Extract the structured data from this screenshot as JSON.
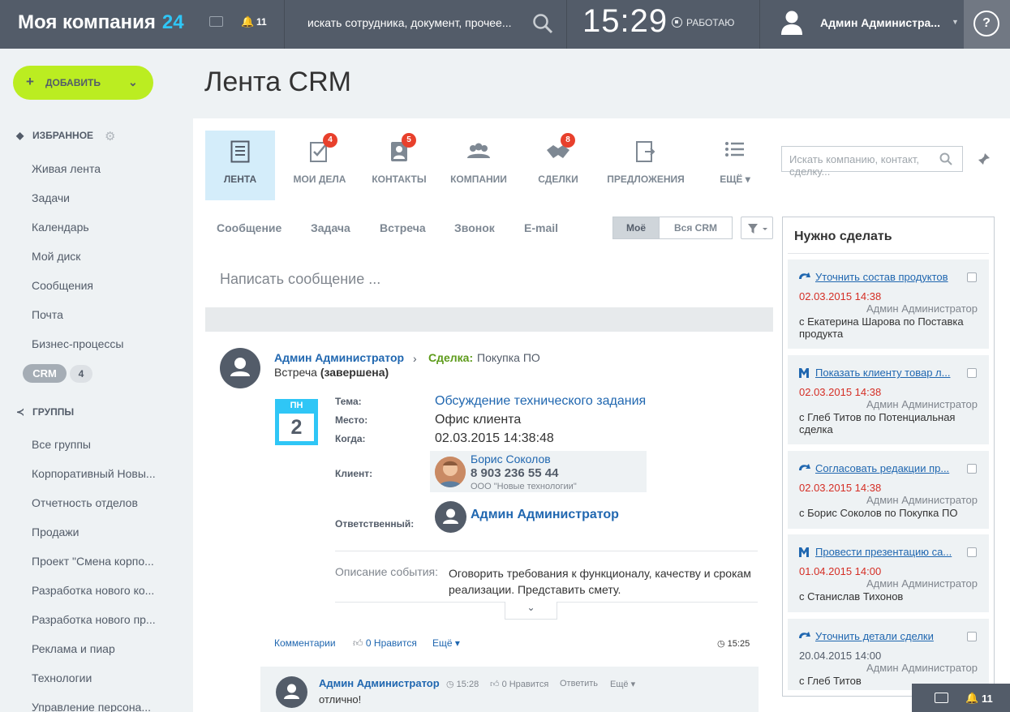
{
  "header": {
    "company": "Моя компания",
    "company_num": "24",
    "notif_count": "11",
    "search_placeholder": "искать сотрудника, документ, прочее...",
    "time": "15:29",
    "work_status": "РАБОТАЮ",
    "user_name": "Админ Администра...",
    "help": "?"
  },
  "sidebar": {
    "add_label": "ДОБАВИТЬ",
    "favorites_title": "ИЗБРАННОЕ",
    "favorites": [
      "Живая лента",
      "Задачи",
      "Календарь",
      "Мой диск",
      "Сообщения",
      "Почта",
      "Бизнес-процессы"
    ],
    "crm_label": "CRM",
    "crm_count": "4",
    "groups_title": "ГРУППЫ",
    "groups": [
      "Все группы",
      "Корпоративный Новы...",
      "Отчетность отделов",
      "Продажи",
      "Проект \"Смена корпо...",
      "Разработка нового ко...",
      "Разработка нового пр...",
      "Реклама и пиар",
      "Технологии",
      "Управление персона..."
    ]
  },
  "page_title": "Лента CRM",
  "tabs": [
    {
      "label": "ЛЕНТА",
      "count": ""
    },
    {
      "label": "МОИ ДЕЛА",
      "count": "4"
    },
    {
      "label": "КОНТАКТЫ",
      "count": "5"
    },
    {
      "label": "КОМПАНИИ",
      "count": ""
    },
    {
      "label": "СДЕЛКИ",
      "count": "8"
    },
    {
      "label": "ПРЕДЛОЖЕНИЯ",
      "count": ""
    },
    {
      "label": "ЕЩЁ",
      "count": ""
    }
  ],
  "crm_search_placeholder": "Искать компанию, контакт, сделку...",
  "activity_tabs": [
    "Сообщение",
    "Задача",
    "Встреча",
    "Звонок",
    "E-mail"
  ],
  "filter": {
    "mine": "Моё",
    "all": "Вся CRM"
  },
  "write_placeholder": "Написать сообщение ...",
  "post": {
    "author": "Админ Администратор",
    "deal_label": "Сделка:",
    "deal_name": "Покупка ПО",
    "meeting": "Встреча",
    "meeting_status": "(завершена)",
    "cal_day": "ПН",
    "cal_date": "2",
    "fields": {
      "topic_label": "Тема:",
      "topic": "Обсуждение технического задания",
      "place_label": "Место:",
      "place": "Офис клиента",
      "when_label": "Когда:",
      "when": "02.03.2015 14:38:48",
      "client_label": "Клиент:",
      "client_name": "Борис Соколов",
      "client_phone": "8 903 236 55 44",
      "client_company": "ООО \"Новые технологии\"",
      "resp_label": "Ответственный:",
      "resp_name": "Админ Администратор"
    },
    "desc_label": "Описание события:",
    "desc": "Оговорить требования к функционалу, качеству и срокам реализации. Представить смету.",
    "comments": "Комментарии",
    "likes": "0 Нравится",
    "more": "Ещё",
    "time": "15:25"
  },
  "comment": {
    "author": "Админ Администратор",
    "time": "15:28",
    "likes": "0 Нравится",
    "reply": "Ответить",
    "more": "Ещё",
    "text": "отлично!"
  },
  "todo": {
    "title": "Нужно сделать",
    "items": [
      {
        "icon": "call-icon",
        "title": "Уточнить состав продуктов",
        "date": "02.03.2015 14:38",
        "overdue": true,
        "who": "Админ Администратор",
        "desc": "с Екатерина Шарова по Поставка продукта"
      },
      {
        "icon": "meeting-icon",
        "title": "Показать клиенту товар л...",
        "date": "02.03.2015 14:38",
        "overdue": true,
        "who": "Админ Администратор",
        "desc": "с Глеб Титов по Потенциальная сделка"
      },
      {
        "icon": "call-icon",
        "title": "Согласовать редакции пр...",
        "date": "02.03.2015 14:38",
        "overdue": true,
        "who": "Админ Администратор",
        "desc": "с Борис Соколов по Покупка ПО"
      },
      {
        "icon": "meeting-icon",
        "title": "Провести презентацию са...",
        "date": "01.04.2015 14:00",
        "overdue": true,
        "who": "Админ Администратор",
        "desc": "с Станислав Тихонов"
      },
      {
        "icon": "call-icon",
        "title": "Уточнить детали сделки",
        "date": "20.04.2015 14:00",
        "overdue": false,
        "who": "Админ Администратор",
        "desc": "с Глеб Титов"
      }
    ]
  },
  "bottom": {
    "notif_count": "11"
  },
  "colors": {
    "header": "#535c69",
    "accent": "#2fc6f6",
    "add_button": "#bbed21",
    "link": "#2067b0",
    "badge": "#e8402c",
    "deal": "#5d9b1a",
    "overdue": "#d52e25"
  }
}
